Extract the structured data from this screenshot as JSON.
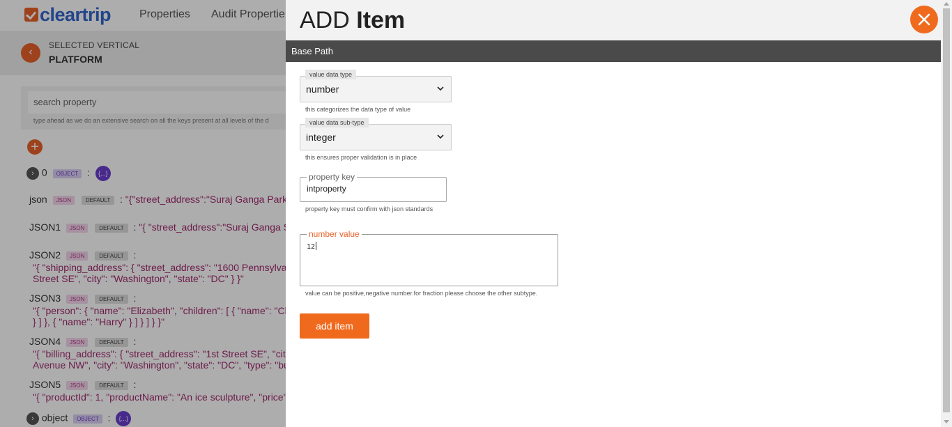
{
  "background": {
    "logo_text": "cleartrip",
    "nav": [
      "Properties",
      "Audit Propertie"
    ],
    "back_icon": "chevron-left-icon",
    "selected_vertical_label": "SELECTED VERTICAL",
    "selected_vertical_value": "PLATFORM",
    "search_placeholder": "search property",
    "search_hint": "type ahead as we do an extensive search on all the keys present at all levels of the d",
    "add_icon": "plus-icon",
    "rows": [
      {
        "key": "0",
        "tag": "OBJECT",
        "bubble": "{...}"
      },
      {
        "key": "json",
        "tag": "JSON",
        "default": "DEFAULT",
        "value": "\"{\"street_address\":\"Suraj Ganga Park"
      },
      {
        "key": "JSON1",
        "tag": "JSON",
        "default": "DEFAULT",
        "value": "\"{ \"street_address\":\"Suraj Ganga S"
      },
      {
        "key": "JSON2",
        "tag": "JSON",
        "default": "DEFAULT",
        "line1": "\"{ \"shipping_address\": { \"street_address\": \"1600 Pennsylva",
        "line2": "Street SE\", \"city\": \"Washington\", \"state\": \"DC\" } }\""
      },
      {
        "key": "JSON3",
        "tag": "JSON",
        "default": "DEFAULT",
        "line1": "\"{ \"person\": { \"name\": \"Elizabeth\", \"children\": [ { \"name\": \"Ch",
        "line2": "} ] }, { \"name\": \"Harry\" } ] } ] } }\""
      },
      {
        "key": "JSON4",
        "tag": "JSON",
        "default": "DEFAULT",
        "line1": "\"{ \"billing_address\": { \"street_address\": \"1st Street SE\", \"cit",
        "line2": "Avenue NW\", \"city\": \"Washington\", \"state\": \"DC\", \"type\": \"bu"
      },
      {
        "key": "JSON5",
        "tag": "JSON",
        "default": "DEFAULT",
        "line1": "\"{ \"productId\": 1, \"productName\": \"An ice sculpture\", \"price\""
      },
      {
        "key": "object",
        "tag": "OBJECT",
        "bubble": "{...}"
      }
    ]
  },
  "drawer": {
    "title_light": "ADD",
    "title_bold": "Item",
    "close_icon": "close-icon",
    "path_label": "Base Path",
    "value_type": {
      "label": "value data type",
      "selected": "number",
      "help": "this categorizes the data type of value"
    },
    "value_subtype": {
      "label": "value data sub-type",
      "selected": "integer",
      "help": "this ensures proper validation is in place"
    },
    "property_key": {
      "label": "property key",
      "value": "intproperty",
      "help": "property key must confirm with json standards"
    },
    "number_value": {
      "label": "number value",
      "value": "12",
      "help": "value can be positive,negative number.for fraction please choose the other subtype."
    },
    "submit_label": "add item"
  },
  "colors": {
    "accent": "#f06a1e",
    "path_bar": "#4a4a4a",
    "json_value": "#a02a6e",
    "object_bubble": "#6a3fd0"
  }
}
